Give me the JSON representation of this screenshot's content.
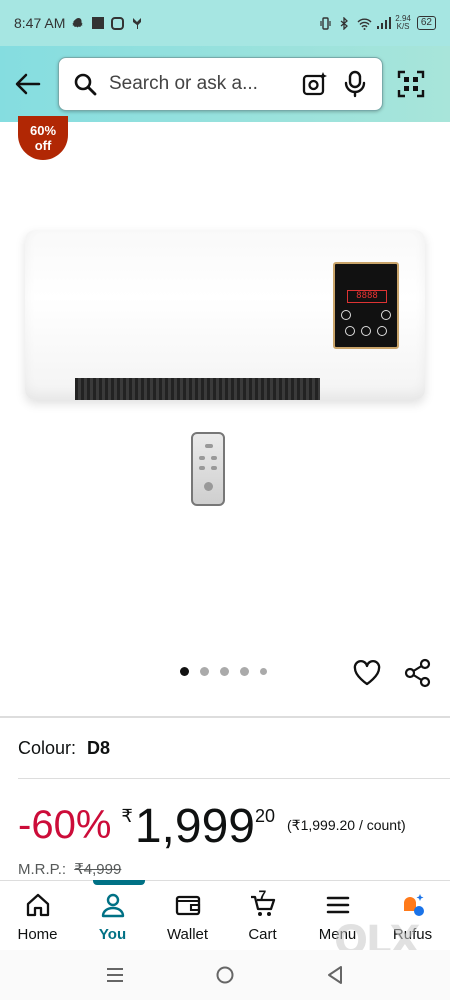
{
  "status_bar": {
    "time": "8:47 AM",
    "net_speed_value": "2.94",
    "net_speed_unit": "K/S",
    "battery": "62"
  },
  "header": {
    "search": {
      "placeholder": "Search or ask a..."
    }
  },
  "product": {
    "discount_badge": {
      "line1": "60%",
      "line2": "off"
    },
    "carousel": {
      "total": 5,
      "active": 0
    }
  },
  "variant": {
    "label": "Colour:",
    "value": "D8"
  },
  "price": {
    "discount": "-60%",
    "currency": "₹",
    "whole": "1,999",
    "fraction": "20",
    "unit_price": "(₹1,999.20 / count)",
    "mrp_label": "M.R.P.:",
    "mrp_value": "₹4,999"
  },
  "bottom_nav": {
    "items": [
      {
        "label": "Home",
        "icon": "home-icon"
      },
      {
        "label": "You",
        "icon": "person-icon",
        "active": true
      },
      {
        "label": "Wallet",
        "icon": "wallet-icon"
      },
      {
        "label": "Cart",
        "icon": "cart-icon",
        "count": "7"
      },
      {
        "label": "Menu",
        "icon": "menu-icon"
      },
      {
        "label": "Rufus",
        "icon": "rufus-icon"
      }
    ]
  },
  "watermark": "OLX",
  "colors": {
    "header_bg": "#85dde0",
    "accent": "#007185",
    "discount_red": "#cc0c39",
    "badge_red": "#b12704"
  }
}
